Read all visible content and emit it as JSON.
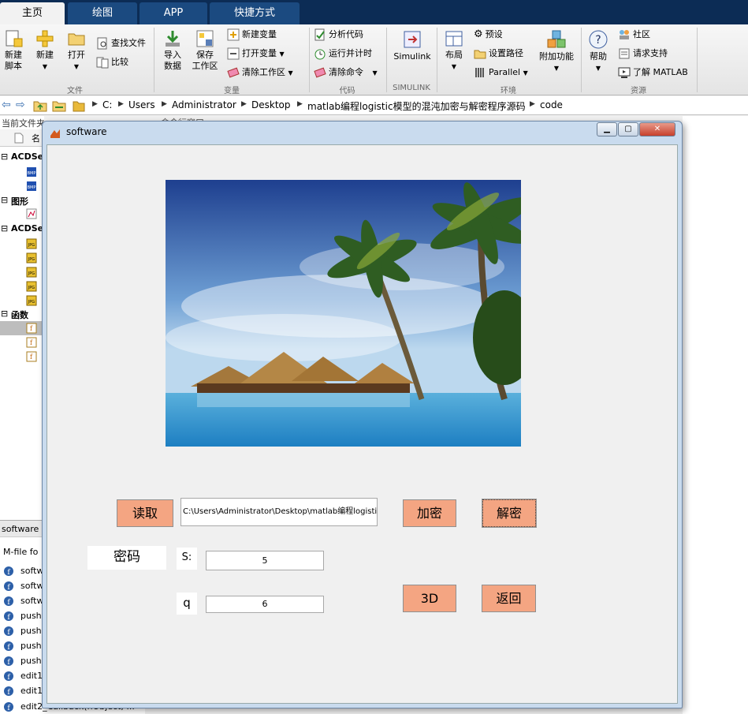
{
  "tabs": [
    "主页",
    "绘图",
    "APP",
    "快捷方式"
  ],
  "ribbon": {
    "new_script": "新建\n脚本",
    "new": "新建",
    "open": "打开",
    "find_files": "查找文件",
    "compare": "比较",
    "import_data": "导入\n数据",
    "save_workspace": "保存\n工作区",
    "new_variable": "新建变量",
    "open_variable": "打开变量",
    "clear_workspace": "清除工作区",
    "analyze_code": "分析代码",
    "run_and_time": "运行并计时",
    "clear_commands": "清除命令",
    "simulink": "Simulink",
    "layout": "布局",
    "preferences": "预设",
    "set_path": "设置路径",
    "parallel": "Parallel",
    "addons": "附加功能",
    "help": "帮助",
    "community": "社区",
    "request_support": "请求支持",
    "learn_matlab": "了解 MATLAB",
    "groups": [
      "文件",
      "变量",
      "代码",
      "SIMULINK",
      "环境",
      "资源"
    ]
  },
  "address": [
    "C:",
    "Users",
    "Administrator",
    "Desktop",
    "matlab编程logistic模型的混沌加密与解密程序源码",
    "code"
  ],
  "left_pane": {
    "header": "当前文件夹",
    "col_header": "名",
    "sections": [
      "ACDSe",
      "图形",
      "ACDSe",
      "函数"
    ],
    "details_header": "software",
    "mfile_label": "M-file fo",
    "functions": [
      "softw",
      "softw",
      "softw",
      "push",
      "push",
      "push",
      "push",
      "edit1",
      "edit1",
      "edit2_Callback(hObject, ..."
    ]
  },
  "bg_header": "命令行窗口",
  "figure": {
    "title": "software",
    "read_button": "读取",
    "path_value": "C:\\Users\\Administrator\\Desktop\\matlab编程logistic模",
    "encrypt_button": "加密",
    "decrypt_button": "解密",
    "password_label": "密码",
    "s_label": "S:",
    "s_value": "5",
    "q_label": "q",
    "q_value": "6",
    "button_3d": "3D",
    "back_button": "返回"
  },
  "colors": {
    "button_fill": "#f4a582",
    "tab_bar": "#0c2c55"
  }
}
